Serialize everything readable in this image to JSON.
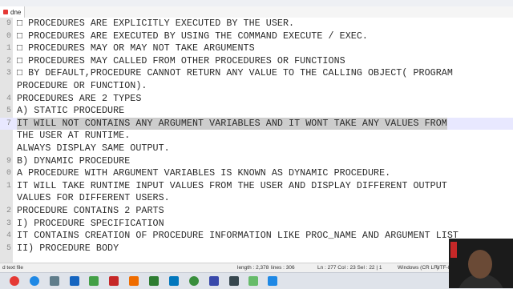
{
  "tab": {
    "label": "dne"
  },
  "editor": {
    "lines": [
      {
        "num": "9",
        "text": "□ PROCEDURES ARE EXPLICITLY EXECUTED BY THE USER."
      },
      {
        "num": "0",
        "text": "□ PROCEDURES ARE EXECUTED BY USING THE COMMAND EXECUTE / EXEC."
      },
      {
        "num": "1",
        "text": "□ PROCEDURES MAY OR MAY NOT TAKE ARGUMENTS"
      },
      {
        "num": "2",
        "text": "□ PROCEDURES MAY CALLED FROM OTHER PROCEDURES OR FUNCTIONS"
      },
      {
        "num": "3",
        "text": "□ BY DEFAULT,PROCEDURE CANNOT RETURN ANY VALUE TO THE CALLING OBJECT( PROGRAM"
      },
      {
        "num": "",
        "text": "PROCEDURE OR FUNCTION)."
      },
      {
        "num": "4",
        "text": "PROCEDURES ARE 2 TYPES"
      },
      {
        "num": "5",
        "text": "A) STATIC PROCEDURE"
      },
      {
        "num": "7",
        "text": "IT WILL NOT CONTAINS ANY ARGUMENT VARIABLES AND IT WONT TAKE ANY VALUES FROM"
      },
      {
        "num": "",
        "text": "THE USER AT RUNTIME."
      },
      {
        "num": "",
        "text": "ALWAYS DISPLAY SAME OUTPUT."
      },
      {
        "num": "9",
        "text": "B) DYNAMIC PROCEDURE"
      },
      {
        "num": "0",
        "text": "A PROCEDURE WITH ARGUMENT VARIABLES IS KNOWN AS DYNAMIC PROCEDURE."
      },
      {
        "num": "1",
        "text": "IT WILL TAKE RUNTIME INPUT VALUES FROM THE USER AND DISPLAY DIFFERENT OUTPUT"
      },
      {
        "num": "",
        "text": "VALUES FOR DIFFERENT USERS."
      },
      {
        "num": "2",
        "text": "PROCEDURE CONTAINS 2 PARTS"
      },
      {
        "num": "3",
        "text": "I) PROCEDURE SPECIFICATION"
      },
      {
        "num": "4",
        "text": "IT CONTAINS CREATION OF PROCEDURE INFORMATION LIKE PROC_NAME AND ARGUMENT LIST"
      },
      {
        "num": "5",
        "text": "II) PROCEDURE BODY"
      }
    ]
  },
  "statusbar": {
    "file_type": "d text file",
    "length": "length : 2,378",
    "lines": "lines : 306",
    "position": "Ln : 277    Col : 23    Sel : 22 | 1",
    "eol": "Windows (CR LF)",
    "encoding": "UTF-8"
  },
  "taskbar": {
    "icons": [
      "chrome-icon",
      "edge-icon",
      "settings-icon",
      "bluetooth-icon",
      "game-icon",
      "pdf-icon",
      "office-icon",
      "excel-icon",
      "screen-icon",
      "green-app-icon",
      "virtualbox-icon",
      "terminal-icon",
      "notepad-icon",
      "c-app-icon"
    ]
  },
  "colors": {
    "gutter": "#e4e4e4",
    "highlight": "#cdcdcd",
    "text": "#2a2a2a",
    "line_number": "#8a8a8a"
  }
}
